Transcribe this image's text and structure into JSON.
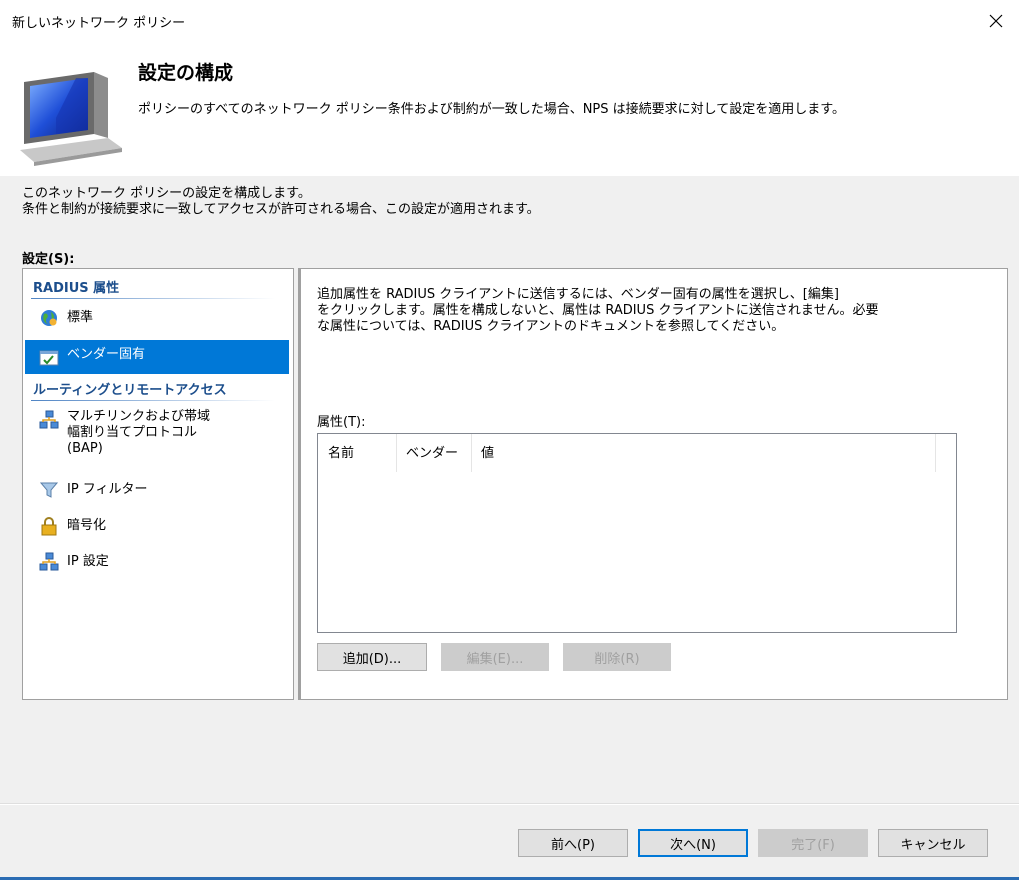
{
  "window": {
    "title": "新しいネットワーク ポリシー"
  },
  "header": {
    "title": "設定の構成",
    "description": "ポリシーのすべてのネットワーク ポリシー条件および制約が一致した場合、NPS は接続要求に対して設定を適用します。"
  },
  "intro": {
    "line1": "このネットワーク ポリシーの設定を構成します。",
    "line2": "条件と制約が接続要求に一致してアクセスが許可される場合、この設定が適用されます。"
  },
  "settings_label": "設定(S):",
  "nav": {
    "group1": "RADIUS 属性",
    "standard": "標準",
    "vendor_specific": "ベンダー固有",
    "group2": "ルーティングとリモートアクセス",
    "multilink_l1": "マルチリンクおよび帯域",
    "multilink_l2": "幅割り当てプロトコル",
    "multilink_l3": "(BAP)",
    "ip_filter": "IP フィルター",
    "encryption": "暗号化",
    "ip_settings": "IP 設定"
  },
  "detail": {
    "info_l1": "追加属性を RADIUS クライアントに送信するには、ベンダー固有の属性を選択し、[編集]",
    "info_l2": "をクリックします。属性を構成しないと、属性は RADIUS クライアントに送信されません。必要",
    "info_l3": "な属性については、RADIUS クライアントのドキュメントを参照してください。",
    "attributes_label": "属性(T):",
    "columns": [
      "名前",
      "ベンダー",
      "値"
    ],
    "add": "追加(D)...",
    "edit": "編集(E)...",
    "remove": "削除(R)"
  },
  "footer": {
    "back": "前へ(P)",
    "next": "次へ(N)",
    "finish": "完了(F)",
    "cancel": "キャンセル"
  }
}
